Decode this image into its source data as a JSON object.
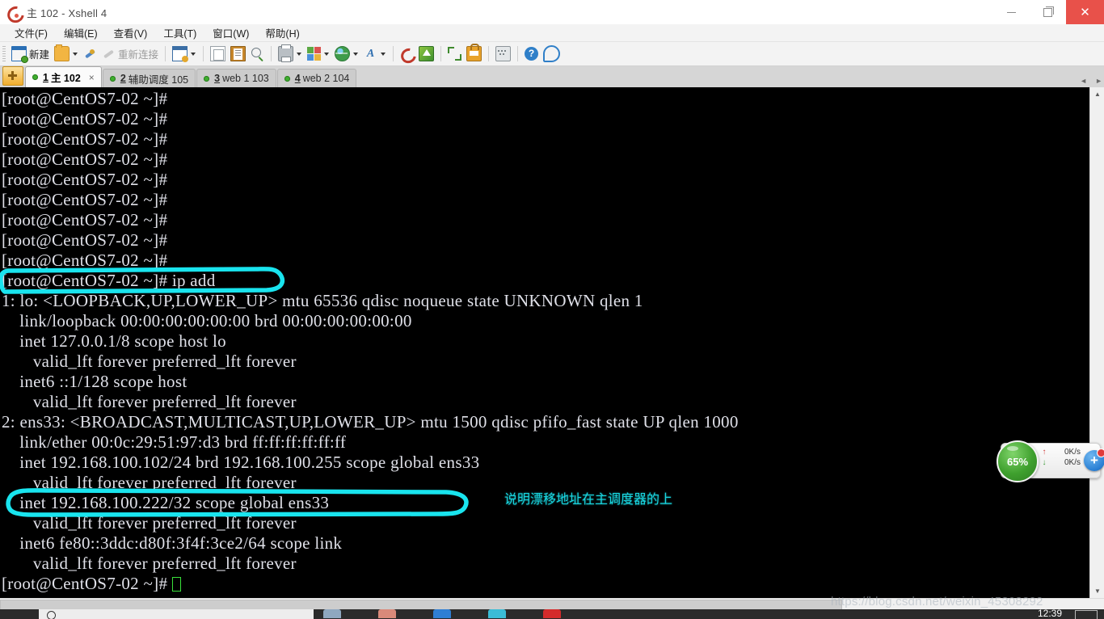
{
  "window": {
    "title": "主 102 - Xshell 4",
    "app_icon": "xshell-icon",
    "controls": {
      "minimize": "—",
      "maximize": "❐",
      "close": "✕"
    }
  },
  "menubar": {
    "items": [
      {
        "label": "文件(F)",
        "name": "menu-file"
      },
      {
        "label": "编辑(E)",
        "name": "menu-edit"
      },
      {
        "label": "查看(V)",
        "name": "menu-view"
      },
      {
        "label": "工具(T)",
        "name": "menu-tools"
      },
      {
        "label": "窗口(W)",
        "name": "menu-window"
      },
      {
        "label": "帮助(H)",
        "name": "menu-help"
      }
    ]
  },
  "toolbar": {
    "new_label": "新建",
    "reconnect_label": "重新连接"
  },
  "tabs": {
    "add_button": "+",
    "items": [
      {
        "num": "1",
        "name": "主 102",
        "active": true,
        "close": "×"
      },
      {
        "num": "2",
        "name": "辅助调度 105",
        "active": false
      },
      {
        "num": "3",
        "name": "web 1 103",
        "active": false
      },
      {
        "num": "4",
        "name": "web 2 104",
        "active": false
      }
    ],
    "scroll_left": "◄",
    "scroll_right": "►"
  },
  "terminal": {
    "lines": [
      "[root@CentOS7-02 ~]#",
      "[root@CentOS7-02 ~]#",
      "[root@CentOS7-02 ~]#",
      "[root@CentOS7-02 ~]#",
      "[root@CentOS7-02 ~]#",
      "[root@CentOS7-02 ~]#",
      "[root@CentOS7-02 ~]#",
      "[root@CentOS7-02 ~]#",
      "[root@CentOS7-02 ~]#",
      "[root@CentOS7-02 ~]# ip add",
      "1: lo: <LOOPBACK,UP,LOWER_UP> mtu 65536 qdisc noqueue state UNKNOWN qlen 1",
      "    link/loopback 00:00:00:00:00:00 brd 00:00:00:00:00:00",
      "    inet 127.0.0.1/8 scope host lo",
      "       valid_lft forever preferred_lft forever",
      "    inet6 ::1/128 scope host",
      "       valid_lft forever preferred_lft forever",
      "2: ens33: <BROADCAST,MULTICAST,UP,LOWER_UP> mtu 1500 qdisc pfifo_fast state UP qlen 1000",
      "    link/ether 00:0c:29:51:97:d3 brd ff:ff:ff:ff:ff:ff",
      "    inet 192.168.100.102/24 brd 192.168.100.255 scope global ens33",
      "       valid_lft forever preferred_lft forever",
      "    inet 192.168.100.222/32 scope global ens33",
      "       valid_lft forever preferred_lft forever",
      "    inet6 fe80::3ddc:d80f:3f4f:3ce2/64 scope link",
      "       valid_lft forever preferred_lft forever",
      "[root@CentOS7-02 ~]# "
    ],
    "cursor": "block-cursor",
    "fg_color": "#dfe0e8",
    "bg_color": "#000000",
    "cursor_color": "#39e03a"
  },
  "annotations": {
    "color": "#19d6e0",
    "note_text": "说明漂移地址在主调度器的上",
    "circled_command_line": "[root@CentOS7-02 ~]# ip add",
    "circled_ip_line": "    inet 192.168.100.222/32 scope global ens33"
  },
  "net_widget": {
    "cpu_percent": "65%",
    "upload_speed": "0K/s",
    "download_speed": "0K/s",
    "up_arrow": "↑",
    "down_arrow": "↓",
    "plus_label": "+"
  },
  "watermark": {
    "text": "https://blog.csdn.net/weixin_45308292"
  },
  "taskbar": {
    "clock": "12:39"
  }
}
